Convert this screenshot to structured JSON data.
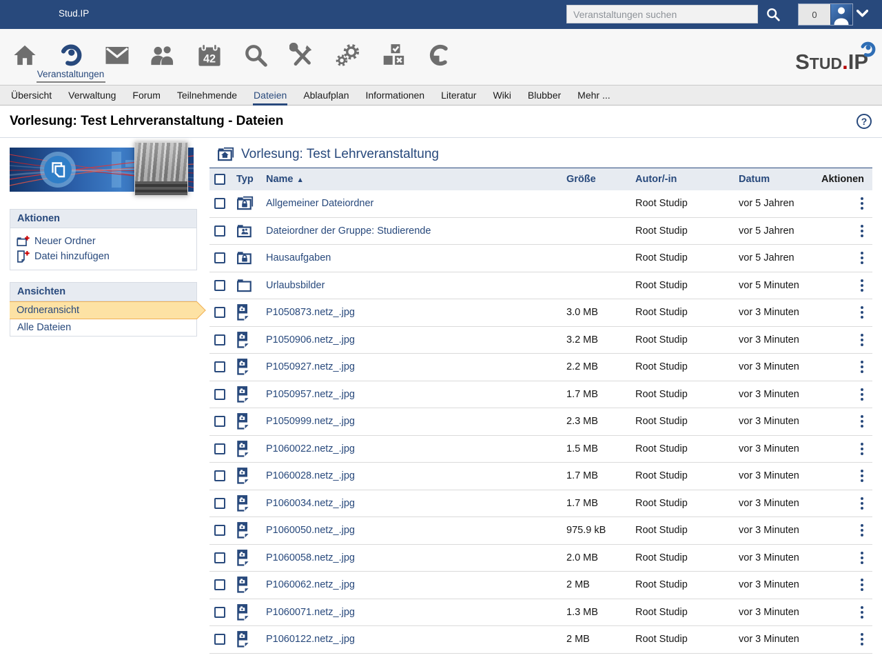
{
  "colors": {
    "brand_blue": "#28497c",
    "icon_gray": "#6e6e6e",
    "accent_red": "#cc0000",
    "highlight_fill": "#fde2a4",
    "highlight_border": "#f0b055",
    "header_bg": "#e7ebf1"
  },
  "topbar": {
    "app_title": "Stud.IP",
    "search_placeholder": "Veranstaltungen suchen",
    "notification_count": "0"
  },
  "brand": {
    "cap1": "S",
    "small": "TUD",
    "dot": ".",
    "cap2": "IP"
  },
  "iconbar": {
    "items": [
      {
        "id": "home",
        "icon": "home-icon"
      },
      {
        "id": "courses",
        "icon": "courses-icon",
        "label": "Veranstaltungen",
        "active": true
      },
      {
        "id": "messages",
        "icon": "mail-icon"
      },
      {
        "id": "community",
        "icon": "community-icon"
      },
      {
        "id": "calendar",
        "icon": "calendar-icon",
        "calendar_text": "42"
      },
      {
        "id": "search",
        "icon": "search-icon"
      },
      {
        "id": "tools",
        "icon": "tools-icon"
      },
      {
        "id": "admin",
        "icon": "gears-icon"
      },
      {
        "id": "evaluation",
        "icon": "vote-icon"
      },
      {
        "id": "resources",
        "icon": "resources-icon"
      }
    ]
  },
  "tabs": [
    {
      "id": "uebersicht",
      "label": "Übersicht"
    },
    {
      "id": "verwaltung",
      "label": "Verwaltung"
    },
    {
      "id": "forum",
      "label": "Forum"
    },
    {
      "id": "teilnehmende",
      "label": "Teilnehmende"
    },
    {
      "id": "dateien",
      "label": "Dateien",
      "active": true
    },
    {
      "id": "ablaufplan",
      "label": "Ablaufplan"
    },
    {
      "id": "informationen",
      "label": "Informationen"
    },
    {
      "id": "literatur",
      "label": "Literatur"
    },
    {
      "id": "wiki",
      "label": "Wiki"
    },
    {
      "id": "blubber",
      "label": "Blubber"
    },
    {
      "id": "mehr",
      "label": "Mehr ..."
    }
  ],
  "page": {
    "title": "Vorlesung: Test Lehrveranstaltung - Dateien",
    "help_glyph": "?"
  },
  "sidebar": {
    "actions": {
      "title": "Aktionen",
      "items": [
        {
          "id": "new-folder",
          "label": "Neuer Ordner",
          "icon": "folder-add-icon"
        },
        {
          "id": "add-file",
          "label": "Datei hinzufügen",
          "icon": "file-add-icon"
        }
      ]
    },
    "views": {
      "title": "Ansichten",
      "items": [
        {
          "id": "folder-view",
          "label": "Ordneransicht",
          "active": true
        },
        {
          "id": "all-files",
          "label": "Alle Dateien"
        }
      ]
    }
  },
  "files": {
    "breadcrumb": {
      "icon": "folder-home-icon",
      "label": "Vorlesung: Test Lehrveranstaltung"
    },
    "columns": {
      "typ": "Typ",
      "name": "Name",
      "size": "Größe",
      "author": "Autor/-in",
      "date": "Datum",
      "actions": "Aktionen"
    },
    "sort_glyph": "▲",
    "rows": [
      {
        "icon": "folder-lock-double-icon",
        "name": "Allgemeiner Dateiordner",
        "size": "",
        "author": "Root Studip",
        "date": "vor 5 Jahren"
      },
      {
        "icon": "folder-group-icon",
        "name": "Dateiordner der Gruppe: Studierende",
        "size": "",
        "author": "Root Studip",
        "date": "vor 5 Jahren"
      },
      {
        "icon": "folder-lock-icon",
        "name": "Hausaufgaben",
        "size": "",
        "author": "Root Studip",
        "date": "vor 5 Jahren"
      },
      {
        "icon": "folder-icon",
        "name": "Urlaubsbilder",
        "size": "",
        "author": "Root Studip",
        "date": "vor 5 Minuten"
      },
      {
        "icon": "file-image-icon",
        "name": "P1050873.netz_.jpg",
        "size": "3.0 MB",
        "author": "Root Studip",
        "date": "vor 3 Minuten"
      },
      {
        "icon": "file-image-icon",
        "name": "P1050906.netz_.jpg",
        "size": "3.2 MB",
        "author": "Root Studip",
        "date": "vor 3 Minuten"
      },
      {
        "icon": "file-image-icon",
        "name": "P1050927.netz_.jpg",
        "size": "2.2 MB",
        "author": "Root Studip",
        "date": "vor 3 Minuten"
      },
      {
        "icon": "file-image-icon",
        "name": "P1050957.netz_.jpg",
        "size": "1.7 MB",
        "author": "Root Studip",
        "date": "vor 3 Minuten"
      },
      {
        "icon": "file-image-icon",
        "name": "P1050999.netz_.jpg",
        "size": "2.3 MB",
        "author": "Root Studip",
        "date": "vor 3 Minuten"
      },
      {
        "icon": "file-image-icon",
        "name": "P1060022.netz_.jpg",
        "size": "1.5 MB",
        "author": "Root Studip",
        "date": "vor 3 Minuten"
      },
      {
        "icon": "file-image-icon",
        "name": "P1060028.netz_.jpg",
        "size": "1.7 MB",
        "author": "Root Studip",
        "date": "vor 3 Minuten"
      },
      {
        "icon": "file-image-icon",
        "name": "P1060034.netz_.jpg",
        "size": "1.7 MB",
        "author": "Root Studip",
        "date": "vor 3 Minuten"
      },
      {
        "icon": "file-image-icon",
        "name": "P1060050.netz_.jpg",
        "size": "975.9 kB",
        "author": "Root Studip",
        "date": "vor 3 Minuten"
      },
      {
        "icon": "file-image-icon",
        "name": "P1060058.netz_.jpg",
        "size": "2.0 MB",
        "author": "Root Studip",
        "date": "vor 3 Minuten"
      },
      {
        "icon": "file-image-icon",
        "name": "P1060062.netz_.jpg",
        "size": "2 MB",
        "author": "Root Studip",
        "date": "vor 3 Minuten"
      },
      {
        "icon": "file-image-icon",
        "name": "P1060071.netz_.jpg",
        "size": "1.3 MB",
        "author": "Root Studip",
        "date": "vor 3 Minuten"
      },
      {
        "icon": "file-image-icon",
        "name": "P1060122.netz_.jpg",
        "size": "2 MB",
        "author": "Root Studip",
        "date": "vor 3 Minuten"
      }
    ]
  }
}
